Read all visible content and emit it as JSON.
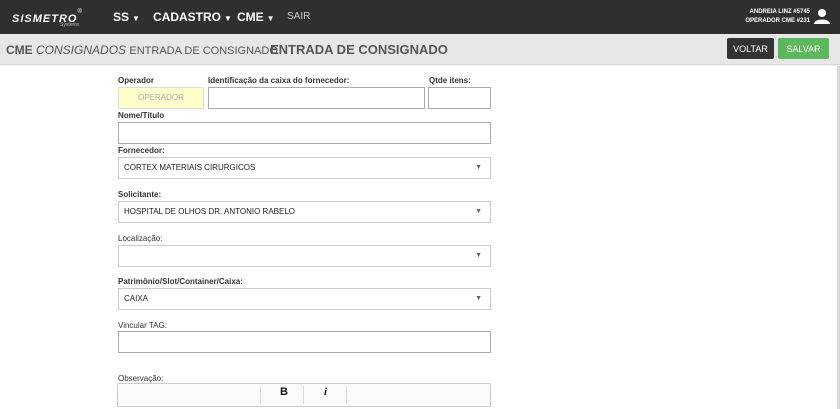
{
  "topbar": {
    "logo_text": "SISMETRO",
    "logo_reg": "®",
    "logo_sub": "Systems",
    "nav": [
      {
        "label": "SS",
        "caret": "▼"
      },
      {
        "label": "CADASTRO",
        "caret": "▼"
      },
      {
        "label": "CME",
        "caret": "▼"
      }
    ],
    "sair": "SAIR",
    "user_line1": "ANDREIA LINZ #5745",
    "user_line2": "OPERADOR CME #231",
    "user_icon": "user-icon"
  },
  "subbar": {
    "crumb_main": "CME",
    "crumb_sub": "CONSIGNADOS",
    "crumb_page": "ENTRADA DE CONSIGNADO",
    "title": "ENTRADA DE CONSIGNADO",
    "voltar": "VOLTAR",
    "salvar": "SALVAR"
  },
  "form": {
    "operador_label": "Operador",
    "operador_value": "OPERADOR",
    "caixa_label": "Identificação da caixa do fornecedor:",
    "qtde_label": "Qtde itens:",
    "nome_label": "Nome/Título",
    "fornecedor_label": "Fornecedor:",
    "fornecedor_value": "CORTEX MATERIAIS CIRURGICOS",
    "solicitante_label": "Solicitante:",
    "solicitante_value": "HOSPITAL DE OLHOS DR. ANTONIO RABELO",
    "localizacao_label": "Localização:",
    "localizacao_value": "",
    "patrimonio_label": "Patrimônio/Slot/Container/Caixa:",
    "patrimonio_value": "CAIXA",
    "tag_label": "Vincular TAG:",
    "obs_label": "Observação:",
    "bold_btn": "B",
    "italic_btn": "i",
    "select_arrow": "▼"
  },
  "colors": {
    "topbar": "#2f2f2f",
    "salvar": "#5cb85c",
    "voltar": "#333333",
    "operador_bg": "#ffffcc"
  }
}
